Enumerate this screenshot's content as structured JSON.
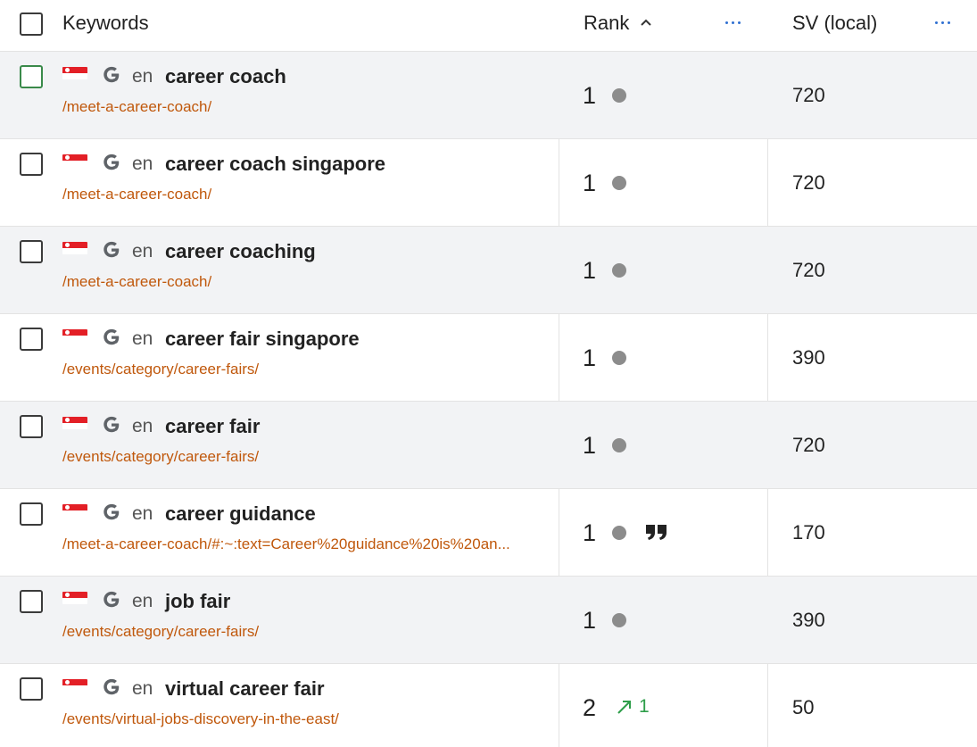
{
  "header": {
    "keywords_label": "Keywords",
    "rank_label": "Rank",
    "sv_label": "SV (local)",
    "sort_direction": "ascending"
  },
  "colors": {
    "url": "#c0580c",
    "more_dots": "#2f6fd1",
    "trend_up": "#2e9e4a",
    "rank_dot": "#8c8c8c",
    "flag_red": "#e31f26"
  },
  "rows": [
    {
      "lang": "en",
      "keyword": "career coach",
      "url": "/meet-a-career-coach/",
      "rank": "1",
      "sv": "720"
    },
    {
      "lang": "en",
      "keyword": "career coach singapore",
      "url": "/meet-a-career-coach/",
      "rank": "1",
      "sv": "720"
    },
    {
      "lang": "en",
      "keyword": "career coaching",
      "url": "/meet-a-career-coach/",
      "rank": "1",
      "sv": "720"
    },
    {
      "lang": "en",
      "keyword": "career fair singapore",
      "url": "/events/category/career-fairs/",
      "rank": "1",
      "sv": "390"
    },
    {
      "lang": "en",
      "keyword": "career fair",
      "url": "/events/category/career-fairs/",
      "rank": "1",
      "sv": "720"
    },
    {
      "lang": "en",
      "keyword": "career guidance",
      "url": "/meet-a-career-coach/#:~:text=Career%20guidance%20is%20an...",
      "rank": "1",
      "sv": "170",
      "feature_icon": "quote-icon"
    },
    {
      "lang": "en",
      "keyword": "job fair",
      "url": "/events/category/career-fairs/",
      "rank": "1",
      "sv": "390"
    },
    {
      "lang": "en",
      "keyword": "virtual career fair",
      "url": "/events/virtual-jobs-discovery-in-the-east/",
      "rank": "2",
      "rank_change": "1",
      "rank_change_icon": "trend-up-icon",
      "sv": "50"
    }
  ]
}
